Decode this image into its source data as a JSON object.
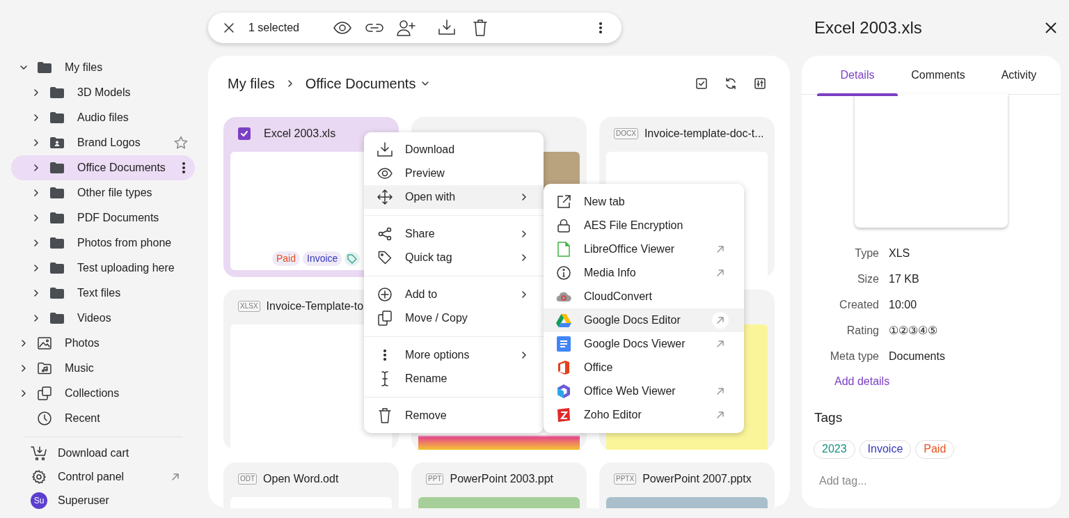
{
  "selection_bar": {
    "count": "1 selected"
  },
  "sidebar": {
    "tree": [
      {
        "label": "My files",
        "kind": "folder",
        "expanded": true,
        "selected": false,
        "hovered": false,
        "children": [
          {
            "label": "3D Models",
            "kind": "folder",
            "expanded": false,
            "selected": false,
            "hovered": false
          },
          {
            "label": "Audio files",
            "kind": "folder",
            "expanded": false,
            "selected": false,
            "hovered": false
          },
          {
            "label": "Brand Logos",
            "kind": "shared_folder",
            "expanded": false,
            "selected": false,
            "hovered": true
          },
          {
            "label": "Office Documents",
            "kind": "folder",
            "expanded": false,
            "selected": true,
            "hovered": false
          },
          {
            "label": "Other file types",
            "kind": "folder",
            "expanded": false,
            "selected": false,
            "hovered": false
          },
          {
            "label": "PDF Documents",
            "kind": "folder",
            "expanded": false,
            "selected": false,
            "hovered": false
          },
          {
            "label": "Photos from phone",
            "kind": "folder",
            "expanded": false,
            "selected": false,
            "hovered": false
          },
          {
            "label": "Test uploading here",
            "kind": "folder",
            "expanded": false,
            "selected": false,
            "hovered": false
          },
          {
            "label": "Text files",
            "kind": "folder",
            "expanded": false,
            "selected": false,
            "hovered": false
          },
          {
            "label": "Videos",
            "kind": "folder",
            "expanded": false,
            "selected": false,
            "hovered": false
          }
        ]
      },
      {
        "label": "Photos",
        "kind": "photos",
        "expanded": false,
        "selected": false,
        "hovered": false
      },
      {
        "label": "Music",
        "kind": "music",
        "expanded": false,
        "selected": false,
        "hovered": false
      },
      {
        "label": "Collections",
        "kind": "collections",
        "expanded": false,
        "selected": false,
        "hovered": false
      },
      {
        "label": "Recent",
        "kind": "recent",
        "selected": false,
        "hovered": false
      }
    ],
    "bottom": [
      {
        "label": "Download cart",
        "kind": "cart"
      },
      {
        "label": "Control panel",
        "kind": "settings"
      },
      {
        "label": "Superuser",
        "kind": "user",
        "avatar": "Su"
      }
    ]
  },
  "breadcrumb": [
    "My files",
    "Office Documents"
  ],
  "files": [
    {
      "name": "Excel 2003.xls",
      "selected": true,
      "tags": [
        {
          "label": "Paid",
          "color": "#e8501e"
        },
        {
          "label": "Invoice",
          "color": "#3437b8"
        }
      ]
    },
    {
      "selected": false
    },
    {
      "name": "Invoice-template-doc-t...",
      "type": "DOCX",
      "selected": false
    },
    {
      "name": "Invoice-Template-to",
      "type": "XLSX",
      "selected": false
    },
    {
      "selected": false
    },
    {
      "selected": false
    },
    {
      "name": "Open Word.odt",
      "type": "ODT",
      "selected": false
    },
    {
      "name": "PowerPoint 2003.ppt",
      "type": "PPT",
      "selected": false
    },
    {
      "name": "PowerPoint 2007.pptx",
      "type": "PPTX",
      "selected": false
    }
  ],
  "context_menu": {
    "sections": [
      [
        {
          "label": "Download",
          "submenu": false,
          "selected": false
        },
        {
          "label": "Preview",
          "submenu": false,
          "selected": false
        },
        {
          "label": "Open with",
          "submenu": true,
          "selected": true
        }
      ],
      [
        {
          "label": "Share",
          "submenu": true,
          "selected": false
        },
        {
          "label": "Quick tag",
          "submenu": true,
          "selected": false
        }
      ],
      [
        {
          "label": "Add to",
          "submenu": true,
          "selected": false
        },
        {
          "label": "Move / Copy",
          "submenu": false,
          "selected": false
        }
      ],
      [
        {
          "label": "More options",
          "submenu": true,
          "selected": false
        },
        {
          "label": "Rename",
          "submenu": false,
          "selected": false
        }
      ],
      [
        {
          "label": "Remove",
          "submenu": false,
          "selected": false
        }
      ]
    ]
  },
  "open_with_menu": [
    {
      "label": "New tab",
      "external": false,
      "selected": false
    },
    {
      "label": "AES File Encryption",
      "external": false,
      "selected": false
    },
    {
      "label": "LibreOffice Viewer",
      "external": true,
      "selected": false
    },
    {
      "label": "Media Info",
      "external": true,
      "selected": false
    },
    {
      "label": "CloudConvert",
      "external": false,
      "selected": false
    },
    {
      "label": "Google Docs Editor",
      "external": true,
      "selected": true
    },
    {
      "label": "Google Docs Viewer",
      "external": true,
      "selected": false
    },
    {
      "label": "Office",
      "external": false,
      "selected": false
    },
    {
      "label": "Office Web Viewer",
      "external": true,
      "selected": false
    },
    {
      "label": "Zoho Editor",
      "external": true,
      "selected": false
    }
  ],
  "details_panel": {
    "title": "Excel 2003.xls",
    "tabs": [
      {
        "label": "Details",
        "selected": true
      },
      {
        "label": "Comments",
        "selected": false
      },
      {
        "label": "Activity",
        "selected": false
      }
    ],
    "fields": [
      {
        "label": "Type",
        "value": "XLS"
      },
      {
        "label": "Size",
        "value": "17 KB"
      },
      {
        "label": "Created",
        "value": "10:00"
      },
      {
        "label": "Rating",
        "value": "①②③④⑤"
      },
      {
        "label": "Meta type",
        "value": "Documents"
      }
    ],
    "add_details": "Add details",
    "tags_heading": "Tags",
    "tags": [
      {
        "label": "2023",
        "color": "#17917f"
      },
      {
        "label": "Invoice",
        "color": "#3437b8"
      },
      {
        "label": "Paid",
        "color": "#e8501e"
      }
    ],
    "tag_input": {
      "placeholder": "Add tag..."
    }
  }
}
